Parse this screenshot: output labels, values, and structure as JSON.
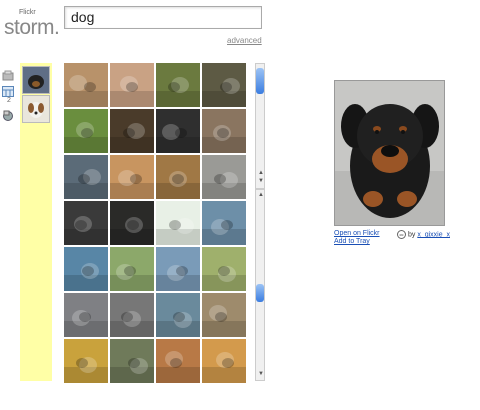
{
  "logo": {
    "small": "Flickr",
    "big": "storm."
  },
  "search": {
    "value": "dog"
  },
  "advanced_link": "advanced",
  "tray": {
    "count": "2"
  },
  "preview": {
    "open_link": "Open on Flickr",
    "tray_link": "Add to Tray",
    "by": "by",
    "author": "x_gixxie_x"
  },
  "grid": {
    "rows": 7,
    "cols": 4,
    "cell_colors": [
      [
        "#b8926a",
        "#c9a284",
        "#6b7a3f",
        "#5d5a44"
      ],
      [
        "#6a8e3e",
        "#4a3b2a",
        "#2f2f2f",
        "#8a7560"
      ],
      [
        "#5b6b78",
        "#c89560",
        "#a07845",
        "#9a9a96"
      ],
      [
        "#3a3a3a",
        "#2a2a28",
        "#e8f0e6",
        "#6d8fa8"
      ],
      [
        "#5886a6",
        "#8ca86a",
        "#7a9bb8",
        "#9fb06c"
      ],
      [
        "#7f8084",
        "#777777",
        "#6a8a9c",
        "#9e8b6c"
      ],
      [
        "#c9a23c",
        "#6f7a5a",
        "#b87946",
        "#d39a4c"
      ]
    ]
  },
  "colors": {
    "tray_bg": "#ffffa6",
    "link": "#1a4fb5",
    "scroll_thumb": "#3b7de0"
  }
}
